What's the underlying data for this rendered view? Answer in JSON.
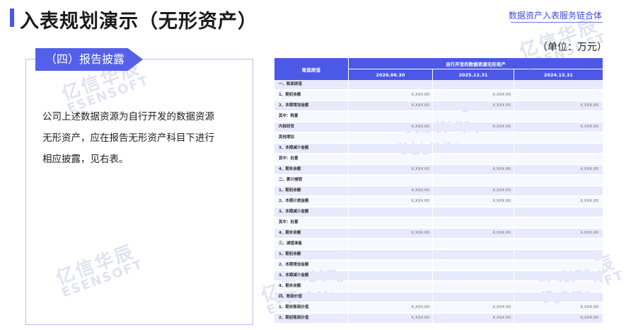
{
  "header": {
    "title": "入表规划演示（无形资产）",
    "brand": "数据资产入表服务链合体"
  },
  "left": {
    "tag": "（四）报告披露",
    "lines": [
      "公司上述数据资源为自行开发的数据资源",
      "无形资产，应在报告无形资产科目下进行",
      "相应披露，见右表。"
    ]
  },
  "watermark": {
    "cn": "亿信华辰",
    "en": "ESENSOFT"
  },
  "unit_label": "（单位：万元）",
  "table": {
    "row_header": "账面原值",
    "group_header": "自行开发的数据资源无形资产",
    "columns": [
      "2026.06.30",
      "2025.12.31",
      "2024.13.31"
    ],
    "rows": [
      {
        "label": "一、账面原值",
        "values": [
          "",
          "",
          ""
        ]
      },
      {
        "label": "1、期初余额",
        "values": [
          "X,XXX.00",
          "X,XXX.00",
          ""
        ]
      },
      {
        "label": "2、本期增加金额",
        "values": [
          "X,XXX.00",
          "X,XXX.00",
          "X,XXX.00"
        ]
      },
      {
        "label": "其中：购置",
        "values": [
          "",
          "",
          ""
        ]
      },
      {
        "label": "内部研发",
        "values": [
          "X,XXX.00",
          "X,XXX.00",
          "X,XXX.00"
        ]
      },
      {
        "label": "其他增加",
        "values": [
          "",
          "",
          ""
        ]
      },
      {
        "label": "3、本期减少金额",
        "values": [
          "",
          "",
          ""
        ]
      },
      {
        "label": "其中：处置",
        "values": [
          "",
          "",
          ""
        ]
      },
      {
        "label": "4、期末余额",
        "values": [
          "X,XXX.00",
          "X,XXX.00",
          "X,XXX.00"
        ]
      },
      {
        "label": "二、累计摊销",
        "values": [
          "",
          "",
          ""
        ]
      },
      {
        "label": "1、期初余额",
        "values": [
          "X,XXX.00",
          "X,XXX.00",
          ""
        ]
      },
      {
        "label": "2、本期计提金额",
        "values": [
          "X,XXX.00",
          "X,XXX.00",
          "X,XXX.00"
        ]
      },
      {
        "label": "3、本期减少金额",
        "values": [
          "",
          "",
          ""
        ]
      },
      {
        "label": "其中：处置",
        "values": [
          "",
          "",
          ""
        ]
      },
      {
        "label": "4、期末余额",
        "values": [
          "X,XXX.00",
          "X,XXX.00",
          "X,XXX.00"
        ]
      },
      {
        "label": "三、减值准备",
        "values": [
          "",
          "",
          ""
        ]
      },
      {
        "label": "1、期初余额",
        "values": [
          "",
          "",
          ""
        ]
      },
      {
        "label": "2、本期增加金额",
        "values": [
          "",
          "",
          ""
        ]
      },
      {
        "label": "3、本期减少金额",
        "values": [
          "",
          "",
          ""
        ]
      },
      {
        "label": "4、期末余额",
        "values": [
          "",
          "",
          ""
        ]
      },
      {
        "label": "四、账面价值",
        "values": [
          "",
          "",
          ""
        ]
      },
      {
        "label": "1、期末账面价值",
        "values": [
          "X,XXX.00",
          "X,XXX.00",
          "X,XXX.00"
        ]
      },
      {
        "label": "2、期初账面价值",
        "values": [
          "X,XXX.00",
          "X,XXX.00",
          "X,XXX.00"
        ]
      }
    ]
  }
}
